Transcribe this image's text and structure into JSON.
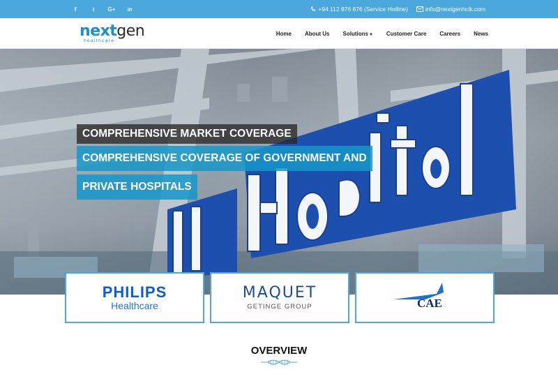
{
  "topbar": {
    "social": [
      {
        "icon": "facebook-icon",
        "glyph": "f"
      },
      {
        "icon": "twitter-icon",
        "glyph": "t"
      },
      {
        "icon": "google-plus-icon",
        "glyph": "G+"
      },
      {
        "icon": "linkedin-icon",
        "glyph": "in"
      }
    ],
    "phone": "+94 112 876 876 (Service Hotline)",
    "email": "info@nextgenhclk.com"
  },
  "logo": {
    "part1": "next",
    "part2": "gen",
    "tagline": "healthcare"
  },
  "nav": {
    "home": "Home",
    "about": "About Us",
    "solutions": "Solutions",
    "customer_care": "Customer Care",
    "careers": "Careers",
    "news": "News"
  },
  "hero": {
    "caption1": "COMPREHENSIVE MARKET COVERAGE",
    "caption2": "COMPREHENSIVE COVERAGE OF GOVERNMENT AND",
    "caption3": "PRIVATE HOSPITALS",
    "sign_text": "Hospital"
  },
  "brands": {
    "philips_name": "PHILIPS",
    "philips_sub": "Healthcare",
    "maquet_name": "MAQUET",
    "maquet_sub": "GETINGE GROUP",
    "cae_name": "CAE"
  },
  "overview": {
    "title": "OVERVIEW"
  },
  "colors": {
    "accent": "#4aa8dd",
    "caption_blue": "#1597c9",
    "caption_dark": "#282828"
  }
}
